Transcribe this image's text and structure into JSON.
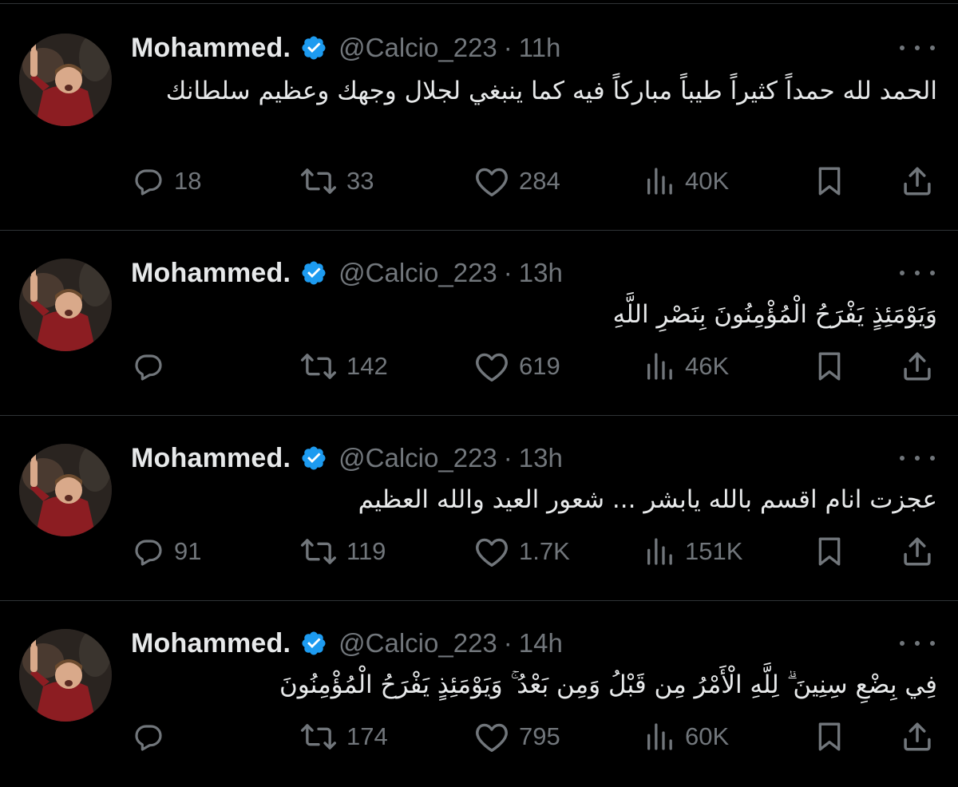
{
  "tweets": [
    {
      "name": "Mohammed.",
      "handle": "@Calcio_223",
      "separator": "·",
      "time": "11h",
      "text": "الحمد لله حمداً كثيراً طيباً مباركاً فيه كما ينبغي لجلال وجهك وعظيم سلطانك",
      "replies": "18",
      "reposts": "33",
      "likes": "284",
      "views": "40K"
    },
    {
      "name": "Mohammed.",
      "handle": "@Calcio_223",
      "separator": "·",
      "time": "13h",
      "text": "وَيَوْمَئِذٍ يَفْرَحُ الْمُؤْمِنُونَ بِنَصْرِ اللَّهِ",
      "replies": "",
      "reposts": "142",
      "likes": "619",
      "views": "46K"
    },
    {
      "name": "Mohammed.",
      "handle": "@Calcio_223",
      "separator": "·",
      "time": "13h",
      "text": "عجزت انام اقسم بالله يابشر ... شعور العيد والله العظيم",
      "replies": "91",
      "reposts": "119",
      "likes": "1.7K",
      "views": "151K"
    },
    {
      "name": "Mohammed.",
      "handle": "@Calcio_223",
      "separator": "·",
      "time": "14h",
      "text": "فِي بِضْعِ سِنِينَ ۗ لِلَّهِ الْأَمْرُ مِن قَبْلُ وَمِن بَعْدُ ۚ وَيَوْمَئِذٍ يَفْرَحُ الْمُؤْمِنُونَ",
      "replies": "",
      "reposts": "174",
      "likes": "795",
      "views": "60K"
    }
  ],
  "icons": {
    "verified": "verified-badge-icon",
    "more": "more-options-icon",
    "reply": "reply-icon",
    "repost": "repost-icon",
    "like": "like-icon",
    "views": "views-icon",
    "bookmark": "bookmark-icon",
    "share": "share-icon"
  },
  "colors": {
    "background": "#000000",
    "text": "#e7e9ea",
    "muted": "#71767b",
    "verified": "#1d9bf0",
    "divider": "#2f3336"
  }
}
